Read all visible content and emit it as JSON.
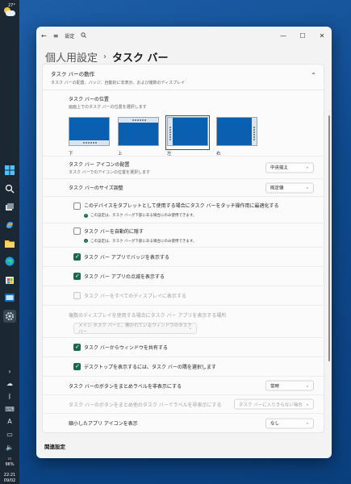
{
  "taskbar": {
    "weather_temp": "27°",
    "battery": "96%",
    "time": "22:21",
    "date": "09/02"
  },
  "window": {
    "title": "設定",
    "breadcrumb_parent": "個人用設定",
    "breadcrumb_separator": "›",
    "breadcrumb_current": "タスク バー"
  },
  "section": {
    "title": "タスク バーの動作",
    "subtitle": "タスク バーの配置、バッジ、自動的に非表示、および複数のディスプレイ"
  },
  "position": {
    "label": "タスク バーの位置",
    "sub": "画面上でのタスク バーの位置を選択します",
    "options": [
      "下",
      "上",
      "左",
      "右"
    ],
    "selected": "左"
  },
  "alignment": {
    "label": "タスク バー アイコンの配置",
    "sub": "タスク バーでのアイコンの位置を選択します",
    "value": "中央揃え"
  },
  "size": {
    "label": "タスク バーのサイズ調整",
    "value": "既定値"
  },
  "tablet": {
    "label": "このデバイスをタブレットとして使用する場合にタスク バーをタッチ操作用に最適化する",
    "info": "この設定は、タスク バーが下部にある場合にのみ使用できます。",
    "checked": false
  },
  "autohide": {
    "label": "タスク バーを自動的に隠す",
    "info": "この設定は、タスク バーが下部にある場合にのみ使用できます。",
    "checked": false
  },
  "badges": {
    "label": "タスク バー アプリでバッジを表示する",
    "checked": true
  },
  "flashing": {
    "label": "タスク バー アプリの点滅を表示する",
    "checked": true
  },
  "all_displays": {
    "label": "タスク バーをすべてのディスプレイに表示する",
    "checked": false,
    "disabled": true
  },
  "multi_display": {
    "label": "複数のディスプレイを使用する場合にタスク バー アプリを表示する場所",
    "value": "メイン タスク バーと、開かれているウィンドウのタスク バー"
  },
  "share_window": {
    "label": "タスク バーからウィンドウを共有する",
    "checked": true
  },
  "desktop_corner": {
    "label": "デスクトップを表示するには、タスク バーの隅を選択します",
    "checked": true
  },
  "combine_buttons": {
    "label": "タスク バーのボタンをまとめラベルを非表示にする",
    "value": "常時"
  },
  "combine_other": {
    "label": "タスク バーのボタンをまとめ他のタスク バーでラベルを非表示にする",
    "value": "タスク バーに入りきらない場合"
  },
  "small_icons": {
    "label": "縮小したアプリ アイコンを表示",
    "value": "なし"
  },
  "related_label": "関連設定",
  "colors": {
    "accent": "#17694f",
    "taskbar_selected": "#0a5fb0",
    "desktop": "#1258a3"
  }
}
